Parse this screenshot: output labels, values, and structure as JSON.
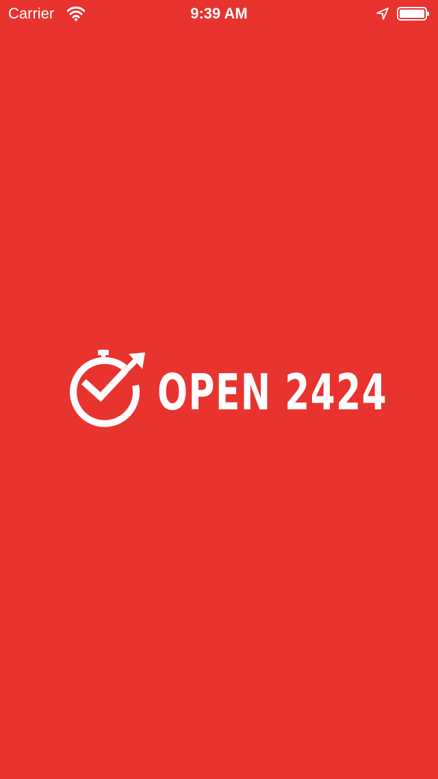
{
  "status_bar": {
    "carrier": "Carrier",
    "time": "9:39 AM",
    "wifi_icon": "wifi-icon",
    "location_icon": "location-arrow-icon",
    "battery_icon": "battery-icon"
  },
  "splash": {
    "brand_name": "OPEN 2424",
    "logo_icon": "stopwatch-check-arrow-icon",
    "background_color": "#E8332F",
    "foreground_color": "#FFFFFF"
  }
}
